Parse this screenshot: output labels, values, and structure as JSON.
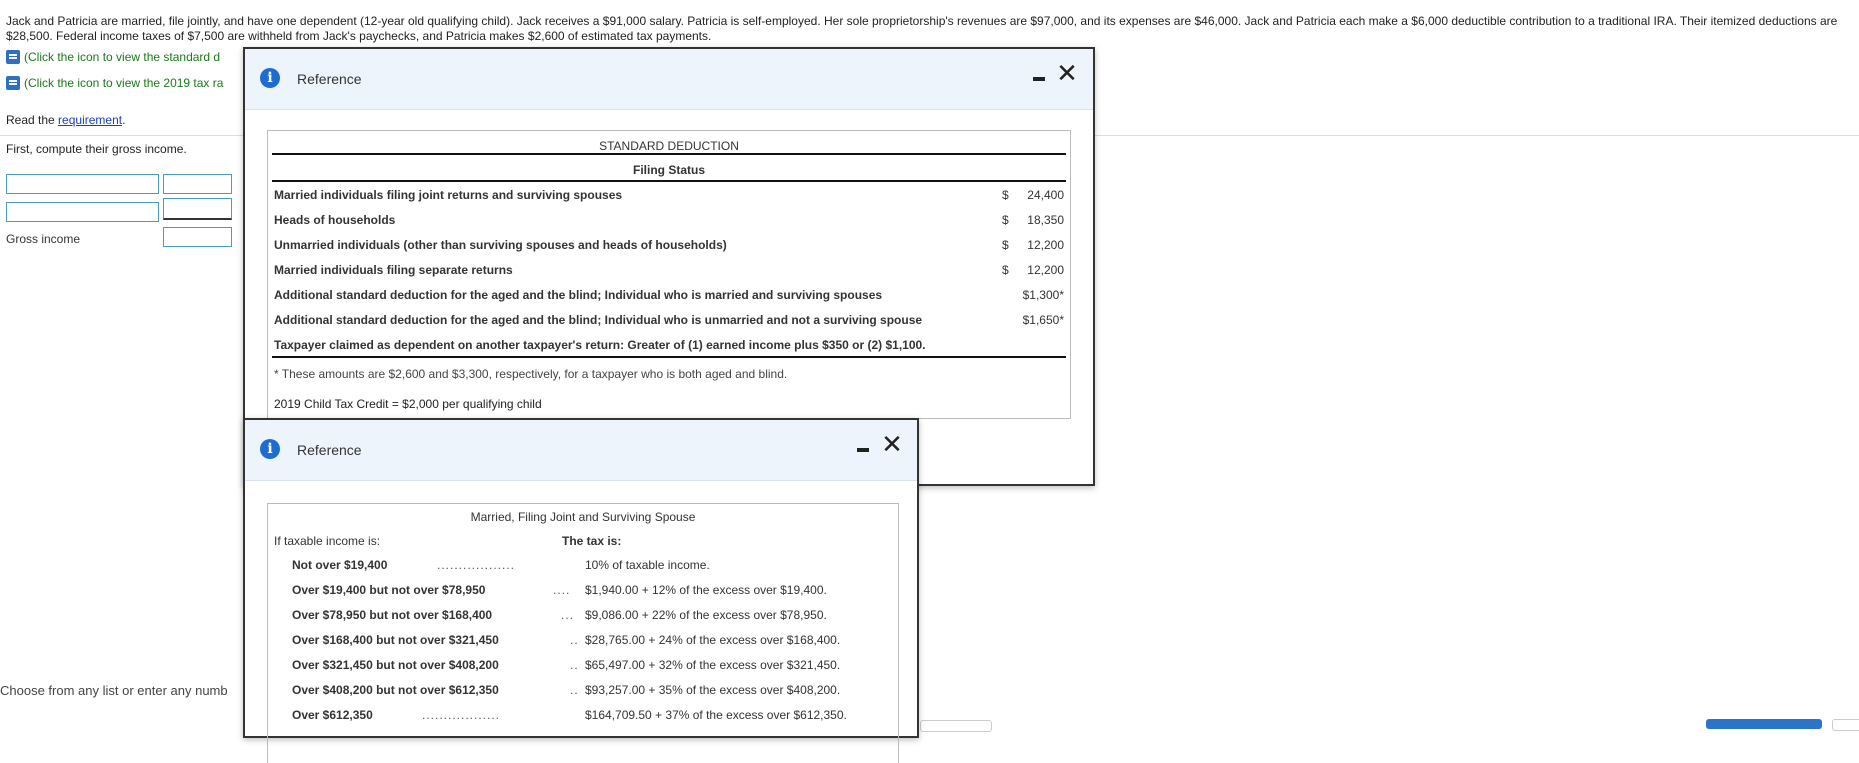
{
  "problem_text": "Jack and Patricia are married, file jointly, and have one dependent (12-year old qualifying child). Jack receives a $91,000 salary. Patricia is self-employed. Her sole proprietorship's revenues are $97,000, and its expenses are $46,000. Jack and Patricia each make a $6,000 deductible contribution to a traditional IRA. Their itemized deductions are $28,500. Federal income taxes of $7,500 are withheld from Jack's paychecks, and Patricia makes $2,600 of estimated tax payments.",
  "links": {
    "standard_link": "(Click the icon to view the standard d",
    "tax_rate_link": "(Click the icon to view the 2019 tax ra"
  },
  "read_prefix": "Read the ",
  "requirement_link": "requirement",
  "read_suffix": ".",
  "compute_text": "First, compute their gross income.",
  "gross_income_label": "Gross income",
  "choose_text": "Choose from any list or enter any numb",
  "dialog1": {
    "title": "Reference",
    "table_title": "STANDARD DEDUCTION",
    "filing_status_header": "Filing Status",
    "rows": [
      {
        "label": "Married individuals filing joint returns and surviving spouses",
        "dollar": "$",
        "amount": "24,400"
      },
      {
        "label": "Heads of households",
        "dollar": "$",
        "amount": "18,350"
      },
      {
        "label": "Unmarried individuals (other than surviving spouses and heads of households)",
        "dollar": "$",
        "amount": "12,200"
      },
      {
        "label": "Married individuals filing separate returns",
        "dollar": "$",
        "amount": "12,200"
      },
      {
        "label": "Additional standard deduction for the aged and the blind; Individual who is married and surviving spouses",
        "dollar": "",
        "amount": "$1,300*"
      },
      {
        "label": "Additional standard deduction for the aged and the blind; Individual who is unmarried and not a surviving spouse",
        "dollar": "",
        "amount": "$1,650*"
      },
      {
        "label": "Taxpayer claimed as dependent on another taxpayer's return: Greater of (1) earned income plus $350 or (2) $1,100.",
        "dollar": "",
        "amount": ""
      }
    ],
    "footnote": "* These amounts are $2,600 and $3,300, respectively, for a taxpayer who is both aged and blind.",
    "child_tax_credit": "2019 Child Tax Credit = $2,000 per qualifying child"
  },
  "dialog2": {
    "title": "Reference",
    "table_title": "Married, Filing Joint and Surviving Spouse",
    "if_header": "If taxable income is:",
    "tax_header": "The tax is:",
    "rows": [
      {
        "range": "Not over $19,400",
        "dots": "..................",
        "tax": "10% of taxable income."
      },
      {
        "range": "Over $19,400 but not over $78,950",
        "dots": "....",
        "tax": "$1,940.00 + 12% of the excess over $19,400."
      },
      {
        "range": "Over $78,950 but not over $168,400",
        "dots": "...",
        "tax": "$9,086.00 + 22% of the excess over $78,950."
      },
      {
        "range": "Over $168,400 but not over $321,450",
        "dots": "..",
        "tax": "$28,765.00 + 24% of the excess over $168,400."
      },
      {
        "range": "Over $321,450 but not over $408,200",
        "dots": "..",
        "tax": "$65,497.00 + 32% of the excess over $321,450."
      },
      {
        "range": "Over $408,200 but not over $612,350",
        "dots": "..",
        "tax": "$93,257.00 + 35% of the excess over $408,200."
      },
      {
        "range": "Over $612,350",
        "dots": "..................",
        "tax": "$164,709.50 + 37% of the excess over $612,350."
      }
    ]
  },
  "icons": {
    "info": "i",
    "close": "✕",
    "book": "book-icon",
    "minimize": "minimize-icon"
  }
}
